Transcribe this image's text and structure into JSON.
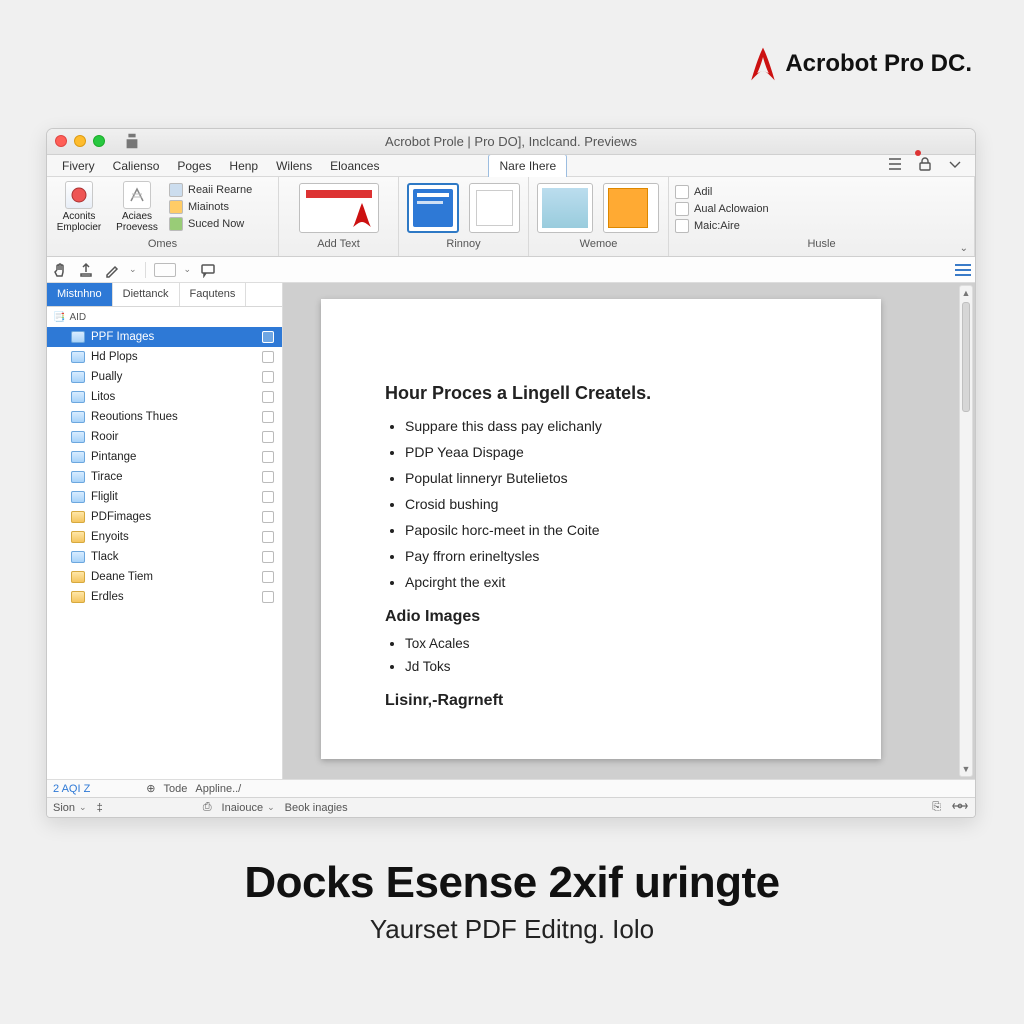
{
  "brand": {
    "label": "Acrobot Pro DC."
  },
  "titlebar": {
    "title": "Acrobot Prole | Pro DO], Inclcand. Previews"
  },
  "menubar": {
    "items": [
      "Fivery",
      "Calienso",
      "Poges",
      "Henp",
      "Wilens",
      "Eloances"
    ],
    "file_tab": "Nare Ihere"
  },
  "ribbon": {
    "group1": {
      "big1": "Aconits Emplocier",
      "big2": "Aciaes Proevess",
      "rows": [
        "Reaii Rearne",
        "Miainots",
        "Suced Now"
      ],
      "label": "Omes"
    },
    "group2": {
      "label": "Add Text"
    },
    "group3": {
      "label": "Rinnoy"
    },
    "group4": {
      "label": "Wemoe"
    },
    "group5": {
      "rows": [
        "Adil",
        "Aual Aclowaion",
        "Maic:Aire"
      ],
      "label": "Husle"
    }
  },
  "side": {
    "tabs": [
      "Mistnhno",
      "Diettanck",
      "Faqutens"
    ],
    "tree_header": "AID",
    "items": [
      {
        "label": "PPF Images",
        "type": "doc",
        "selected": true
      },
      {
        "label": "Hd Plops",
        "type": "doc"
      },
      {
        "label": "Pually",
        "type": "doc"
      },
      {
        "label": "Litos",
        "type": "doc"
      },
      {
        "label": "Reoutions Thues",
        "type": "doc"
      },
      {
        "label": "Rooir",
        "type": "doc"
      },
      {
        "label": "Pintange",
        "type": "doc"
      },
      {
        "label": "Tirace",
        "type": "doc"
      },
      {
        "label": "Fliglit",
        "type": "doc"
      },
      {
        "label": "PDFimages",
        "type": "folder"
      },
      {
        "label": "Enyoits",
        "type": "folder"
      },
      {
        "label": "Tlack",
        "type": "doc"
      },
      {
        "label": "Deane Tiem",
        "type": "folder"
      },
      {
        "label": "Erdles",
        "type": "folder"
      }
    ]
  },
  "doc": {
    "h1": "Hour Proces a Lingell Createls.",
    "bullets1": [
      "Suppare this dass pay elichanly",
      "PDP Yeaa Dispage",
      "Populat linneryr Butelietos",
      "Crosid bushing",
      "Paposilc horc-meet in the Coite",
      "Pay ffrorn erineltysles",
      "Apcirght the exit"
    ],
    "h2": "Adio Images",
    "bullets2": [
      "Tox Acales",
      "Jd Toks"
    ],
    "h3": "Lisinr,-Ragrneft"
  },
  "footer": {
    "left": "2 AQI Z",
    "mid1": "Tode",
    "mid2": "Appline../"
  },
  "status": {
    "item1": "Sion",
    "item2": "Inaiouce",
    "item3": "Beok inagies"
  },
  "promo": {
    "headline": "Docks Esense 2xif uringte",
    "sub": "Yaurset PDF Editng. Iolo"
  }
}
